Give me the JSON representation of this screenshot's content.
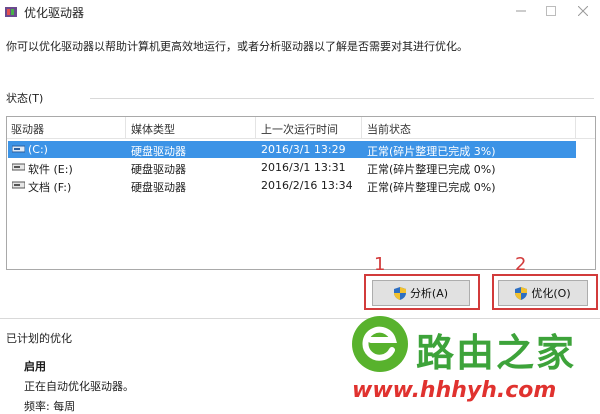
{
  "window": {
    "title": "优化驱动器",
    "description": "你可以优化驱动器以帮助计算机更高效地运行，或者分析驱动器以了解是否需要对其进行优化。"
  },
  "status_section": {
    "label": "状态(T)"
  },
  "table": {
    "columns": [
      "驱动器",
      "媒体类型",
      "上一次运行时间",
      "当前状态"
    ],
    "rows": [
      {
        "drive": "(C:)",
        "media": "硬盘驱动器",
        "last_run": "2016/3/1 13:29",
        "status": "正常(碎片整理已完成 3%)",
        "selected": true
      },
      {
        "drive": "软件 (E:)",
        "media": "硬盘驱动器",
        "last_run": "2016/3/1 13:31",
        "status": "正常(碎片整理已完成 0%)",
        "selected": false
      },
      {
        "drive": "文档 (F:)",
        "media": "硬盘驱动器",
        "last_run": "2016/2/16 13:34",
        "status": "正常(碎片整理已完成 0%)",
        "selected": false
      }
    ]
  },
  "buttons": {
    "analyze": {
      "label": "分析(A)",
      "annotation": "1"
    },
    "optimize": {
      "label": "优化(O)",
      "annotation": "2"
    }
  },
  "scheduled": {
    "title": "已计划的优化",
    "state": "启用",
    "status_text": "正在自动优化驱动器。",
    "frequency": "频率: 每周"
  },
  "watermark": {
    "text": "路由之家",
    "url": "www.hhhyh.com"
  },
  "colors": {
    "selection": "#3c93e6",
    "annotation": "#d23b3b",
    "watermark_green": "#3da33a",
    "watermark_red": "#e0322f"
  },
  "icons": [
    "app-icon",
    "minimize-icon",
    "maximize-icon",
    "close-icon",
    "drive-icon",
    "shield-icon"
  ]
}
